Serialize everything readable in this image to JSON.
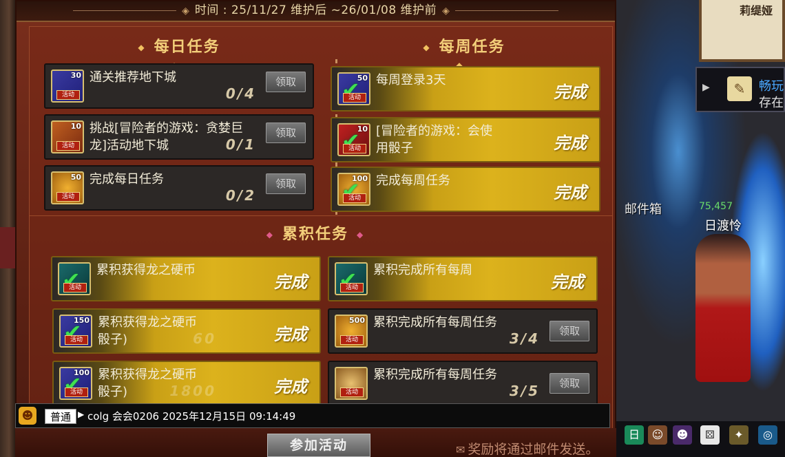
{
  "header": {
    "time_text": "时间 : 25/11/27 维护后 ~26/01/08 维护前"
  },
  "daily": {
    "title": "每日任务",
    "tasks": [
      {
        "name": "通关推荐地下城",
        "progress": "0/4",
        "reward": "30",
        "button": "领取"
      },
      {
        "name": "挑战[冒险者的游戏：贪婪巨龙]活动地下城",
        "progress": "0/1",
        "reward": "10",
        "button": "领取"
      },
      {
        "name": "完成每日任务",
        "progress": "0/2",
        "reward": "50",
        "button": "领取"
      }
    ]
  },
  "weekly": {
    "title": "每周任务",
    "tasks": [
      {
        "name": "每周登录3天",
        "status": "完成",
        "reward": "50"
      },
      {
        "name": "[冒险者的游戏：会使用骰子",
        "status": "完成",
        "reward": "10"
      },
      {
        "name": "完成每周任务",
        "status": "完成",
        "reward": "100"
      }
    ]
  },
  "cumulative": {
    "title": "累积任务",
    "tasks": [
      {
        "name": "累积获得龙之硬币",
        "status": "完成",
        "reward": ""
      },
      {
        "name": "累积完成所有每周",
        "status": "完成",
        "reward": ""
      },
      {
        "name": "累积获得龙之硬币骰子)",
        "status": "完成",
        "reward": "150",
        "faded": "60"
      },
      {
        "name": "累积完成所有每周任务",
        "progress": "3/4",
        "reward": "500",
        "button": "领取"
      },
      {
        "name": "累积获得龙之硬币骰子)",
        "status": "完成",
        "reward": "100",
        "faded": "1800"
      },
      {
        "name": "累积完成所有每周任务",
        "progress": "3/5",
        "reward": "",
        "button": "领取"
      }
    ]
  },
  "badge_label": "活动",
  "chat": {
    "channel": "普通",
    "message": "colg 会会0206 2025年12月15日 09:14:49"
  },
  "join_button": "参加活动",
  "mail_note": "奖励将通过邮件发送。",
  "game": {
    "npc_name": "莉缇娅",
    "quest_line1": "畅玩",
    "quest_line2": "存在",
    "mailbox_label": "邮件箱",
    "player_hp": "75,457",
    "player_name": "日渡怜"
  },
  "colors": {
    "gold": "#dcb21c",
    "panel": "#7a2e1c",
    "title": "#f3cf7a",
    "check": "#3fe04f"
  },
  "icons": [
    "activity-reward-icon",
    "check-icon",
    "chat-emote-icon",
    "mail-icon",
    "quest-scroll-icon"
  ]
}
